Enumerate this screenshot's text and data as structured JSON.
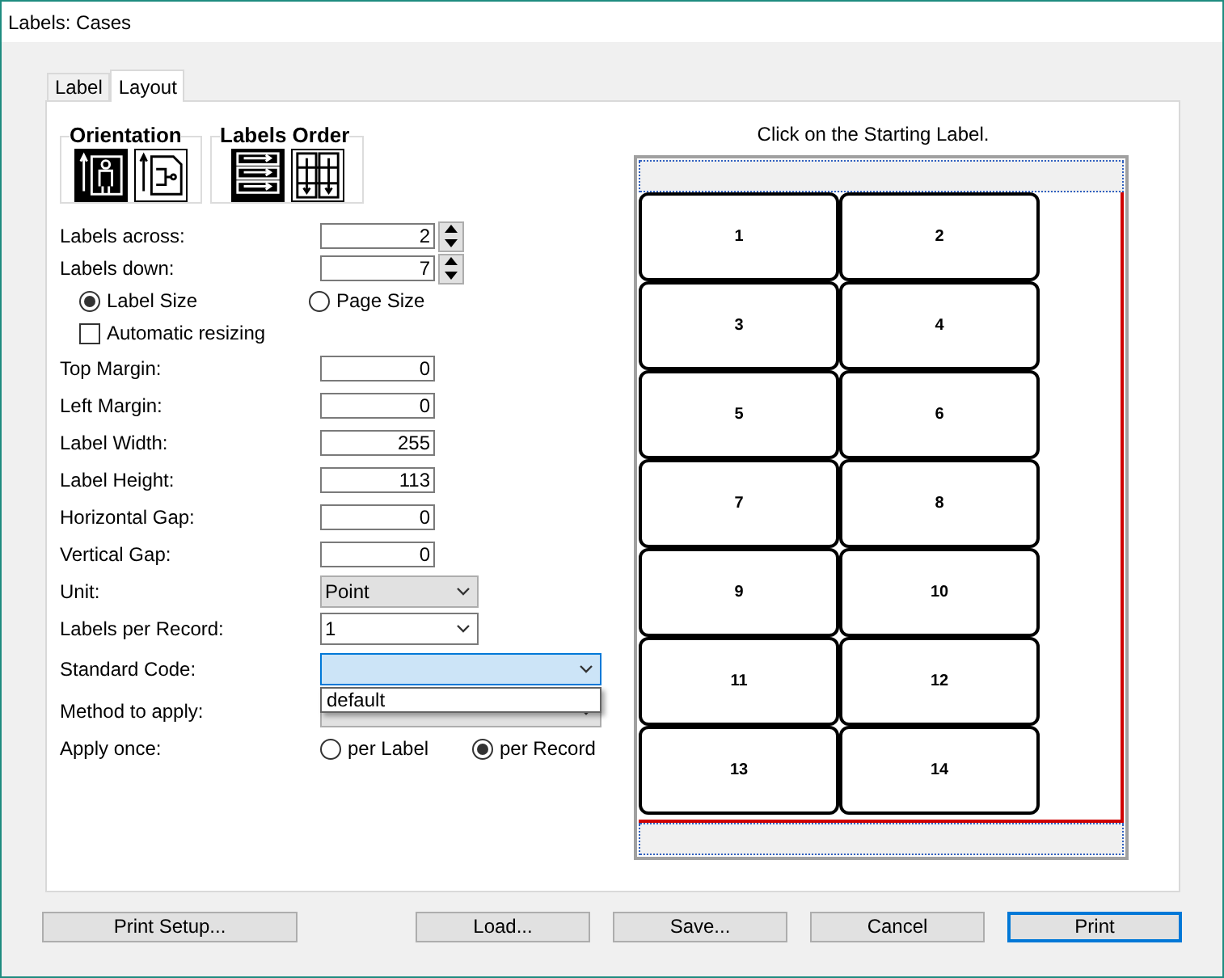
{
  "window": {
    "title": "Labels: Cases"
  },
  "tabs": [
    {
      "label": "Label",
      "selected": false
    },
    {
      "label": "Layout",
      "selected": true
    }
  ],
  "orientation": {
    "title": "Orientation",
    "options": [
      {
        "kind": "portrait",
        "selected": true
      },
      {
        "kind": "landscape",
        "selected": false
      }
    ]
  },
  "labels_order": {
    "title": "Labels Order",
    "options": [
      {
        "kind": "across",
        "selected": true
      },
      {
        "kind": "down",
        "selected": false
      }
    ]
  },
  "fields": [
    {
      "kind": "spin",
      "label": "Labels across:",
      "value": "2"
    },
    {
      "kind": "spin",
      "label": "Labels down:",
      "value": "7"
    },
    {
      "kind": "radios",
      "options": [
        {
          "label": "Label Size",
          "selected": true
        },
        {
          "label": "Page Size",
          "selected": false
        }
      ]
    },
    {
      "kind": "checkbox",
      "label": "Automatic resizing",
      "checked": false
    },
    {
      "kind": "number",
      "label": "Top Margin:",
      "value": "0"
    },
    {
      "kind": "number",
      "label": "Left Margin:",
      "value": "0"
    },
    {
      "kind": "number",
      "label": "Label Width:",
      "value": "255"
    },
    {
      "kind": "number",
      "label": "Label Height:",
      "value": "113"
    },
    {
      "kind": "number",
      "label": "Horizontal Gap:",
      "value": "0"
    },
    {
      "kind": "number",
      "label": "Vertical Gap:",
      "value": "0"
    },
    {
      "kind": "select",
      "label": "Unit:",
      "value": "Point"
    },
    {
      "kind": "combo",
      "label": "Labels per Record:",
      "value": "1"
    },
    {
      "kind": "combo",
      "label": "Standard Code:",
      "focused": true,
      "open_options": [
        "default"
      ]
    },
    {
      "kind": "select",
      "label": "Method to apply:"
    },
    {
      "kind": "radios",
      "label": "Apply once:",
      "options": [
        {
          "label": "per Label",
          "selected": false
        },
        {
          "label": "per Record",
          "selected": true
        }
      ]
    }
  ],
  "preview": {
    "instruction": "Click on the Starting Label.",
    "labels": [
      "1",
      "2",
      "3",
      "4",
      "5",
      "6",
      "7",
      "8",
      "9",
      "10",
      "11",
      "12",
      "13",
      "14"
    ]
  },
  "buttons": [
    {
      "label": "Print Setup...",
      "default": false
    },
    {
      "label": "Load...",
      "default": false
    },
    {
      "label": "Save...",
      "default": false
    },
    {
      "label": "Cancel",
      "default": false
    },
    {
      "label": "Print",
      "default": true
    }
  ]
}
